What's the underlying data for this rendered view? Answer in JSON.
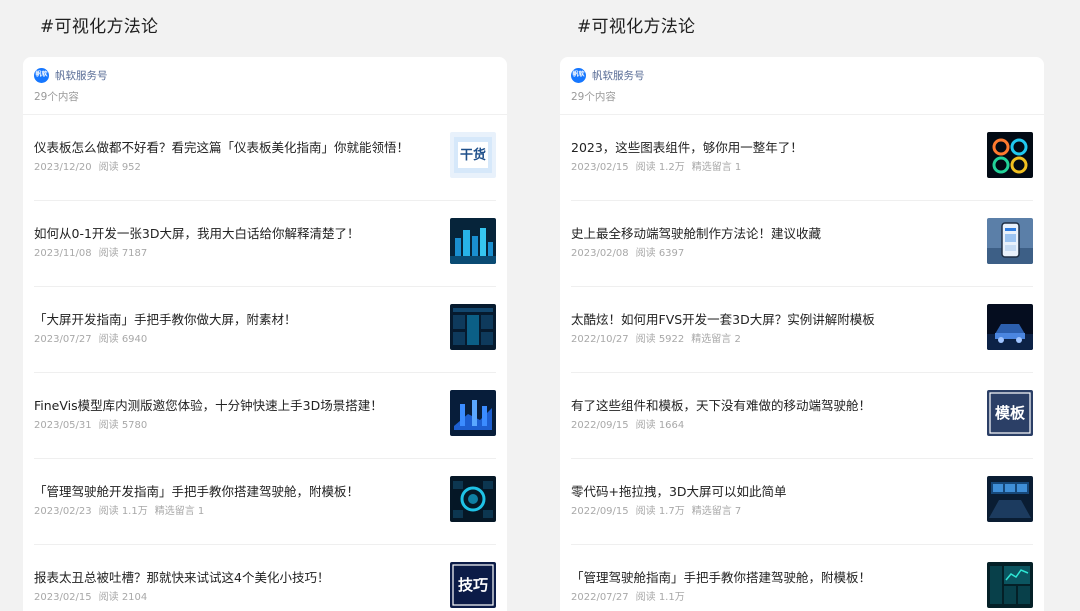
{
  "columns": [
    {
      "heading": "#可视化方法论",
      "account": {
        "logo_text": "帆软",
        "name": "帆软服务号",
        "count": "29个内容"
      },
      "articles": [
        {
          "title": "仪表板怎么做都不好看？看完这篇「仪表板美化指南」你就能领悟！",
          "date": "2023/12/20",
          "reads": "阅读 952",
          "comments": "",
          "thumb": "ganhuo",
          "thumb_text": "干货"
        },
        {
          "title": "如何从0-1开发一张3D大屏，我用大白话给你解释清楚了！",
          "date": "2023/11/08",
          "reads": "阅读 7187",
          "comments": "",
          "thumb": "city",
          "thumb_text": ""
        },
        {
          "title": "「大屏开发指南」手把手教你做大屏，附素材！",
          "date": "2023/07/27",
          "reads": "阅读 6940",
          "comments": "",
          "thumb": "dash",
          "thumb_text": ""
        },
        {
          "title": "FineVis模型库内测版邀您体验，十分钟快速上手3D场景搭建！",
          "date": "2023/05/31",
          "reads": "阅读 5780",
          "comments": "",
          "thumb": "city2",
          "thumb_text": ""
        },
        {
          "title": "「管理驾驶舱开发指南」手把手教你搭建驾驶舱，附模板！",
          "date": "2023/02/23",
          "reads": "阅读 1.1万",
          "comments": "精选留言 1",
          "thumb": "ring",
          "thumb_text": ""
        },
        {
          "title": "报表太丑总被吐槽？那就快来试试这4个美化小技巧！",
          "date": "2023/02/15",
          "reads": "阅读 2104",
          "comments": "",
          "thumb": "jiqiao",
          "thumb_text": "技巧"
        }
      ]
    },
    {
      "heading": "#可视化方法论",
      "account": {
        "logo_text": "帆软",
        "name": "帆软服务号",
        "count": "29个内容"
      },
      "articles": [
        {
          "title": "2023，这些图表组件，够你用一整年了！",
          "date": "2023/02/15",
          "reads": "阅读 1.2万",
          "comments": "精选留言 1",
          "thumb": "charts",
          "thumb_text": ""
        },
        {
          "title": "史上最全移动端驾驶舱制作方法论！建议收藏",
          "date": "2023/02/08",
          "reads": "阅读 6397",
          "comments": "",
          "thumb": "phone",
          "thumb_text": ""
        },
        {
          "title": "太酷炫！如何用FVS开发一套3D大屏？实例讲解附模板",
          "date": "2022/10/27",
          "reads": "阅读 5922",
          "comments": "精选留言 2",
          "thumb": "car",
          "thumb_text": ""
        },
        {
          "title": "有了这些组件和模板，天下没有难做的移动端驾驶舱！",
          "date": "2022/09/15",
          "reads": "阅读 1664",
          "comments": "",
          "thumb": "moban",
          "thumb_text": "模板"
        },
        {
          "title": "零代码+拖拉拽，3D大屏可以如此简单",
          "date": "2022/09/15",
          "reads": "阅读 1.7万",
          "comments": "精选留言 7",
          "thumb": "room",
          "thumb_text": ""
        },
        {
          "title": "「管理驾驶舱指南」手把手教你搭建驾驶舱，附模板！",
          "date": "2022/07/27",
          "reads": "阅读 1.1万",
          "comments": "",
          "thumb": "tealdash",
          "thumb_text": ""
        }
      ]
    }
  ]
}
